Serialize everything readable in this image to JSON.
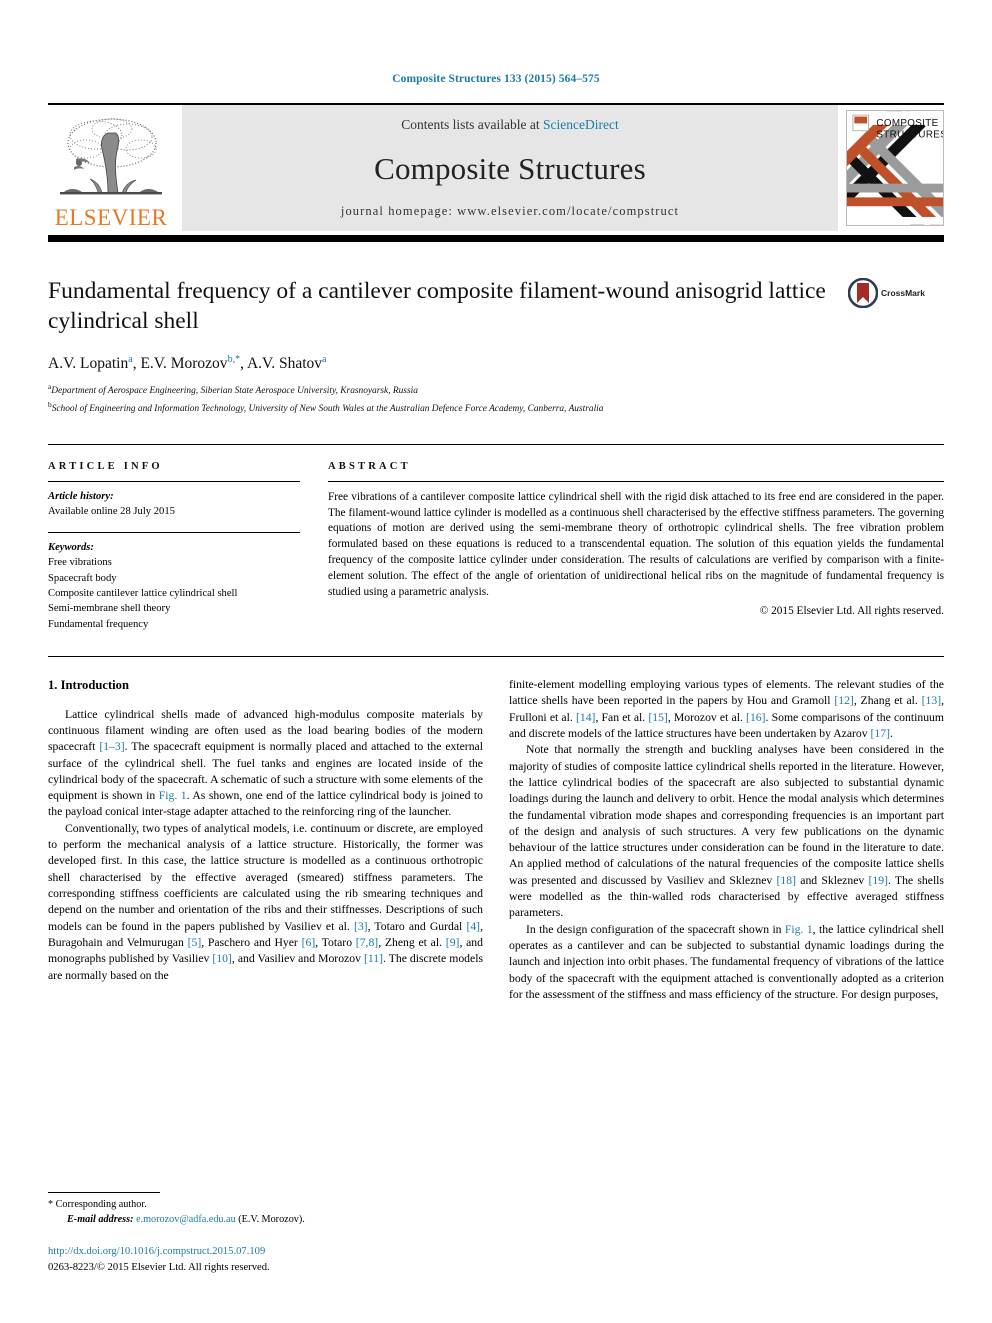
{
  "running_head": "Composite Structures 133 (2015) 564–575",
  "accent_color": "#1a7aa8",
  "elsevier_orange": "#E87722",
  "masthead": {
    "contents_prefix": "Contents lists available at ",
    "sciencedirect": "ScienceDirect",
    "journal_title": "Composite Structures",
    "homepage": "journal homepage: www.elsevier.com/locate/compstruct",
    "publisher_wordmark": "ELSEVIER",
    "cover_line1": "COMPOSITE",
    "cover_line2": "STRUCTURES"
  },
  "article": {
    "title": "Fundamental frequency of a cantilever composite filament-wound anisogrid lattice cylindrical shell",
    "crossmark_label": "CrossMark",
    "authors": [
      {
        "name": "A.V. Lopatin",
        "sup": "a"
      },
      {
        "name": "E.V. Morozov",
        "sup": "b,*"
      },
      {
        "name": "A.V. Shatov",
        "sup": "a"
      }
    ],
    "affiliations": [
      {
        "label": "a",
        "text": "Department of Aerospace Engineering, Siberian State Aerospace University, Krasnoyarsk, Russia"
      },
      {
        "label": "b",
        "text": "School of Engineering and Information Technology, University of New South Wales at the Australian Defence Force Academy, Canberra, Australia"
      }
    ]
  },
  "article_info": {
    "heading": "ARTICLE INFO",
    "history_label": "Article history:",
    "history_value": "Available online 28 July 2015",
    "keywords_label": "Keywords:",
    "keywords": [
      "Free vibrations",
      "Spacecraft body",
      "Composite cantilever lattice cylindrical shell",
      "Semi-membrane shell theory",
      "Fundamental frequency"
    ]
  },
  "abstract": {
    "heading": "ABSTRACT",
    "text": "Free vibrations of a cantilever composite lattice cylindrical shell with the rigid disk attached to its free end are considered in the paper. The filament-wound lattice cylinder is modelled as a continuous shell characterised by the effective stiffness parameters. The governing equations of motion are derived using the semi-membrane theory of orthotropic cylindrical shells. The free vibration problem formulated based on these equations is reduced to a transcendental equation. The solution of this equation yields the fundamental frequency of the composite lattice cylinder under consideration. The results of calculations are verified by comparison with a finite-element solution. The effect of the angle of orientation of unidirectional helical ribs on the magnitude of fundamental frequency is studied using a parametric analysis.",
    "copyright": "© 2015 Elsevier Ltd. All rights reserved."
  },
  "body": {
    "section_heading": "1. Introduction",
    "left_paragraphs": [
      "Lattice cylindrical shells made of advanced high-modulus composite materials by continuous filament winding are often used as the load bearing bodies of the modern spacecraft [1–3]. The spacecraft equipment is normally placed and attached to the external surface of the cylindrical shell. The fuel tanks and engines are located inside of the cylindrical body of the spacecraft. A schematic of such a structure with some elements of the equipment is shown in Fig. 1. As shown, one end of the lattice cylindrical body is joined to the payload conical inter-stage adapter attached to the reinforcing ring of the launcher.",
      "Conventionally, two types of analytical models, i.e. continuum or discrete, are employed to perform the mechanical analysis of a lattice structure. Historically, the former was developed first. In this case, the lattice structure is modelled as a continuous orthotropic shell characterised by the effective averaged (smeared) stiffness parameters. The corresponding stiffness coefficients are calculated using the rib smearing techniques and depend on the number and orientation of the ribs and their stiffnesses. Descriptions of such models can be found in the papers published by Vasiliev et al. [3], Totaro and Gurdal [4], Buragohain and Velmurugan [5], Paschero and Hyer [6], Totaro [7,8], Zheng et al. [9], and monographs published by Vasiliev [10], and Vasiliev and Morozov [11]. The discrete models are normally based on the"
    ],
    "right_paragraphs": [
      "finite-element modelling employing various types of elements. The relevant studies of the lattice shells have been reported in the papers by Hou and Gramoll [12], Zhang et al. [13], Frulloni et al. [14], Fan et al. [15], Morozov et al. [16]. Some comparisons of the continuum and discrete models of the lattice structures have been undertaken by Azarov [17].",
      "Note that normally the strength and buckling analyses have been considered in the majority of studies of composite lattice cylindrical shells reported in the literature. However, the lattice cylindrical bodies of the spacecraft are also subjected to substantial dynamic loadings during the launch and delivery to orbit. Hence the modal analysis which determines the fundamental vibration mode shapes and corresponding frequencies is an important part of the design and analysis of such structures. A very few publications on the dynamic behaviour of the lattice structures under consideration can be found in the literature to date. An applied method of calculations of the natural frequencies of the composite lattice shells was presented and discussed by Vasiliev and Skleznev [18] and Skleznev [19]. The shells were modelled as the thin-walled rods characterised by effective averaged stiffness parameters.",
      "In the design configuration of the spacecraft shown in Fig. 1, the lattice cylindrical shell operates as a cantilever and can be subjected to substantial dynamic loadings during the launch and injection into orbit phases. The fundamental frequency of vibrations of the lattice body of the spacecraft with the equipment attached is conventionally adopted as a criterion for the assessment of the stiffness and mass efficiency of the structure. For design purposes,"
    ]
  },
  "footer": {
    "corresponding_marker": "*",
    "corresponding_text": "Corresponding author.",
    "email_label": "E-mail address:",
    "email": "e.morozov@adfa.edu.au",
    "email_owner": "(E.V. Morozov).",
    "doi": "http://dx.doi.org/10.1016/j.compstruct.2015.07.109",
    "issn_line": "0263-8223/© 2015 Elsevier Ltd. All rights reserved."
  }
}
